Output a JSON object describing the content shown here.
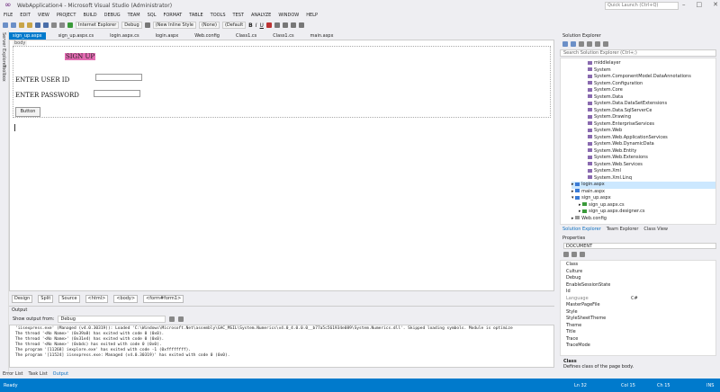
{
  "window": {
    "title": "WebApplication4 - Microsoft Visual Studio (Administrator)",
    "quick_launch_placeholder": "Quick Launch (Ctrl+Q)"
  },
  "menu": [
    "FILE",
    "EDIT",
    "VIEW",
    "PROJECT",
    "BUILD",
    "DEBUG",
    "TEAM",
    "SQL",
    "FORMAT",
    "TABLE",
    "TOOLS",
    "TEST",
    "ANALYZE",
    "WINDOW",
    "HELP"
  ],
  "toolbar": {
    "browser": "Internet Explorer",
    "config": "Debug",
    "style": "(New Inline Style",
    "font_name": "(None)",
    "font_size": "(Default",
    "bold": "B",
    "italic": "I",
    "underline": "U"
  },
  "side_tabs": [
    "Server Explorer",
    "Toolbox"
  ],
  "doc_tabs": [
    "sign_up.aspx",
    "sign_up.aspx.cs",
    "login.aspx.cs",
    "login.aspx",
    "Web.config",
    "Class1.cs",
    "Class1.cs",
    "main.aspx"
  ],
  "designer": {
    "body_tag": "body",
    "signup_label": "SIGN UP",
    "user_id_label": "ENTER USER ID",
    "password_label": "ENTER PASSWORD",
    "button_label": "Button"
  },
  "design_bar": {
    "design": "Design",
    "split": "Split",
    "source": "Source",
    "crumbs": [
      "<html>",
      "<body>",
      "<form#form1>"
    ]
  },
  "output": {
    "title": "Output",
    "show_from_label": "Show output from:",
    "show_from_value": "Debug",
    "lines": [
      "'iisexpress.exe' (Managed (v4.0.30319)): Loaded 'C:\\Windows\\Microsoft.Net\\assembly\\GAC_MSIL\\System.Numerics\\v4.0_4.0.0.0__b77a5c561934e089\\System.Numerics.dll'. Skipped loading symbols. Module is optimize",
      "The thread '<No Name>' (0x39a8) has exited with code 0 (0x0).",
      "The thread '<No Name>' (0x31e4) has exited with code 0 (0x0).",
      "The thread '<No Name>' (0xbdc) has exited with code 0 (0x0).",
      "The program '[11268] iexplore.exe' has exited with code -1 (0xffffffff).",
      "The program '[11524] iisexpress.exe: Managed (v4.0.30319)' has exited with code 0 (0x0)."
    ]
  },
  "bottom_tabs": [
    "Error List",
    "Task List",
    "Output"
  ],
  "solution_explorer": {
    "title": "Solution Explorer",
    "search_placeholder": "Search Solution Explorer (Ctrl+;)",
    "items": [
      "middlelayer",
      "System",
      "System.ComponentModel.DataAnnotations",
      "System.Configuration",
      "System.Core",
      "System.Data",
      "System.Data.DataSetExtensions",
      "System.Data.SqlServerCe",
      "System.Drawing",
      "System.EnterpriseServices",
      "System.Web",
      "System.Web.ApplicationServices",
      "System.Web.DynamicData",
      "System.Web.Entity",
      "System.Web.Extensions",
      "System.Web.Services",
      "System.Xml",
      "System.Xml.Linq",
      "login.aspx",
      "main.aspx",
      "sign_up.aspx",
      "sign_up.aspx.cs",
      "sign_up.aspx.designer.cs",
      "Web.config"
    ],
    "tabs": [
      "Solution Explorer",
      "Team Explorer",
      "Class View"
    ]
  },
  "properties": {
    "title": "Properties",
    "object": "DOCUMENT",
    "rows": [
      {
        "name": "Class",
        "value": ""
      },
      {
        "name": "Culture",
        "value": ""
      },
      {
        "name": "Debug",
        "value": ""
      },
      {
        "name": "EnableSessionState",
        "value": ""
      },
      {
        "name": "Id",
        "value": ""
      },
      {
        "name": "Language",
        "value": "C#"
      },
      {
        "name": "MasterPageFile",
        "value": ""
      },
      {
        "name": "Style",
        "value": ""
      },
      {
        "name": "StyleSheetTheme",
        "value": ""
      },
      {
        "name": "Theme",
        "value": ""
      },
      {
        "name": "Title",
        "value": ""
      },
      {
        "name": "Trace",
        "value": ""
      },
      {
        "name": "TraceMode",
        "value": ""
      }
    ],
    "desc_title": "Class",
    "desc_text": "Defines class of the page body."
  },
  "status": {
    "ready": "Ready",
    "line": "Ln 32",
    "col": "Col 15",
    "ch": "Ch 15",
    "ins": "INS"
  },
  "colors": {
    "accent": "#007acc",
    "signup_bg": "#e36bb2"
  }
}
